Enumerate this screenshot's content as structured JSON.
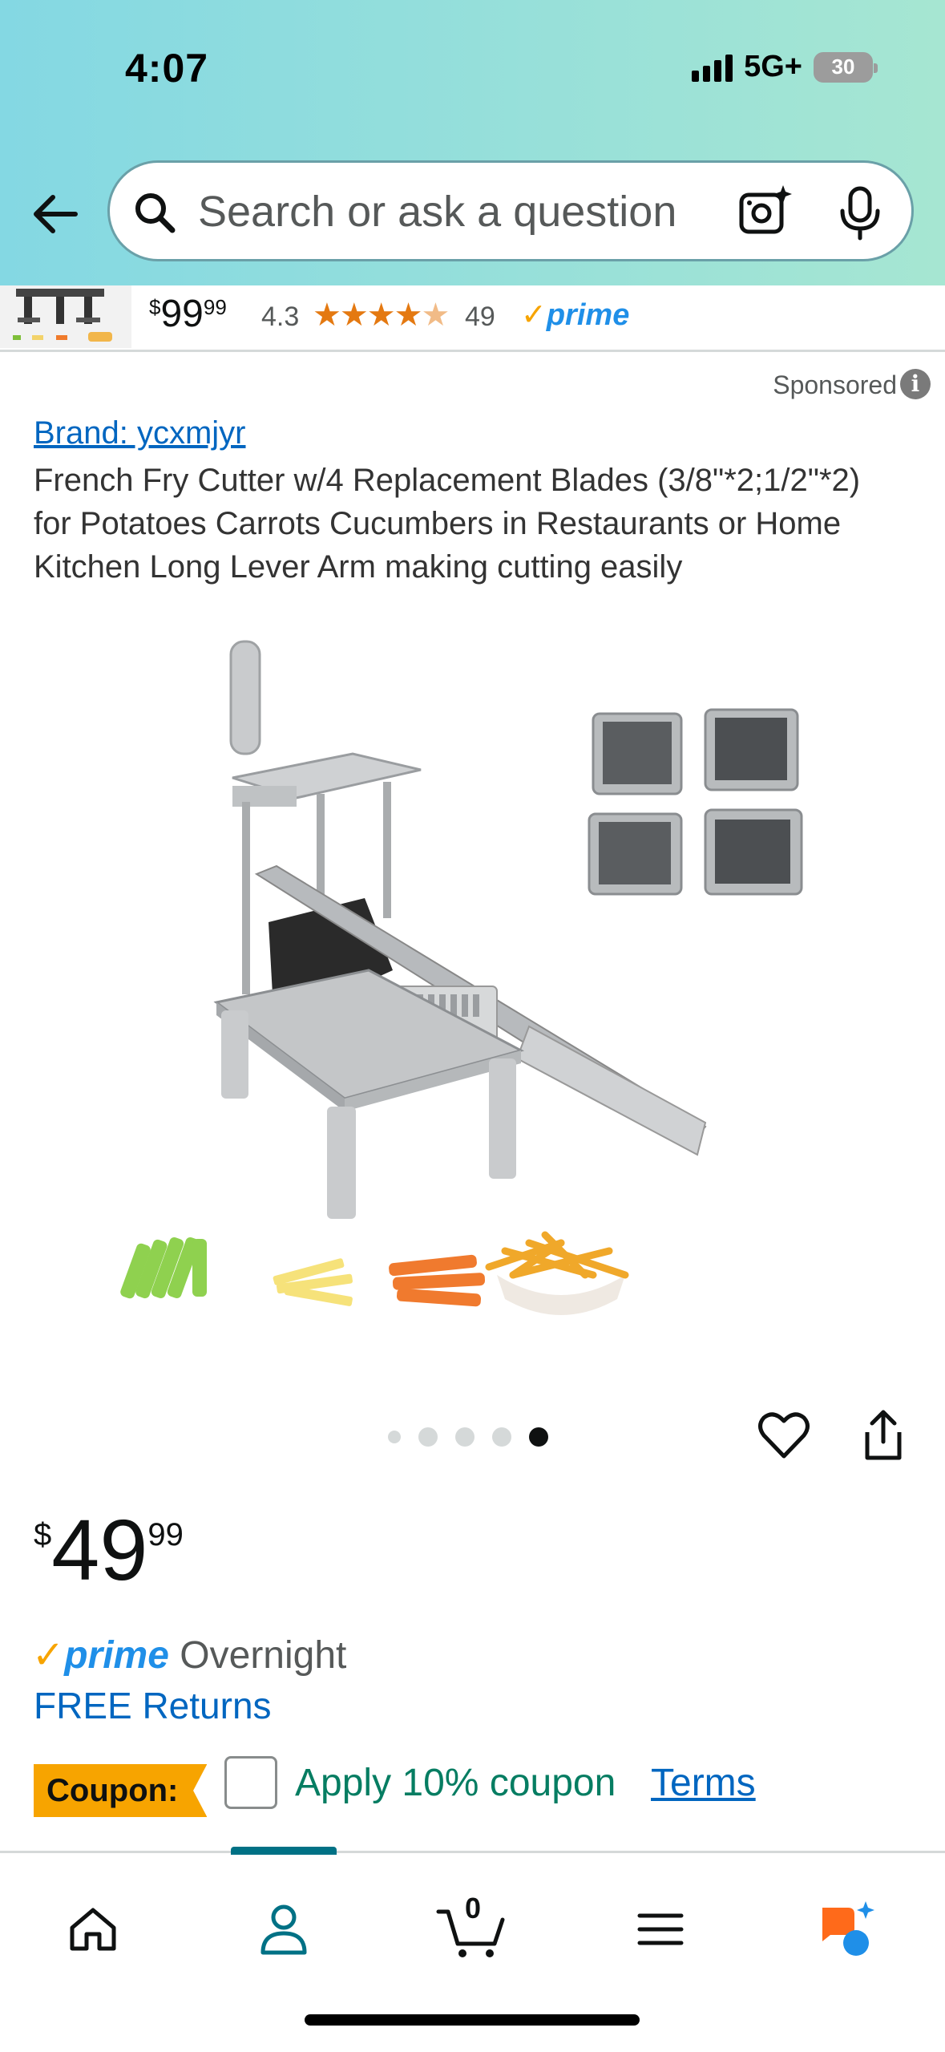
{
  "status_bar": {
    "time": "4:07",
    "network": "5G+",
    "battery": "30"
  },
  "search": {
    "placeholder": "Search or ask a question"
  },
  "sticky_product": {
    "price_whole": "99",
    "price_frac": "99",
    "rating": "4.3",
    "rating_count": "49",
    "prime_label": "prime"
  },
  "sponsored_label": "Sponsored",
  "product": {
    "brand": "Brand: ycxmjyr",
    "title": "French Fry Cutter w/4 Replacement Blades (3/8\"*2;1/2\"*2) for Potatoes Carrots Cucumbers in Restaurants or Home Kitchen Long Lever Arm making cutting easily",
    "image_count": 5,
    "current_image": 5,
    "price_currency": "$",
    "price_whole": "49",
    "price_frac": "99",
    "prime_label": "prime",
    "delivery": "Overnight",
    "returns": "FREE Returns",
    "coupon_label": "Coupon:",
    "coupon_text": "Apply 10% coupon",
    "terms_label": "Terms"
  },
  "tab_bar": {
    "cart_count": "0",
    "active_tab": "account"
  },
  "colors": {
    "accent_blue": "#0066c0",
    "prime_blue": "#1f8fe8",
    "coupon_orange": "#f7a400",
    "coupon_green": "#067d62",
    "active_teal": "#007185"
  }
}
